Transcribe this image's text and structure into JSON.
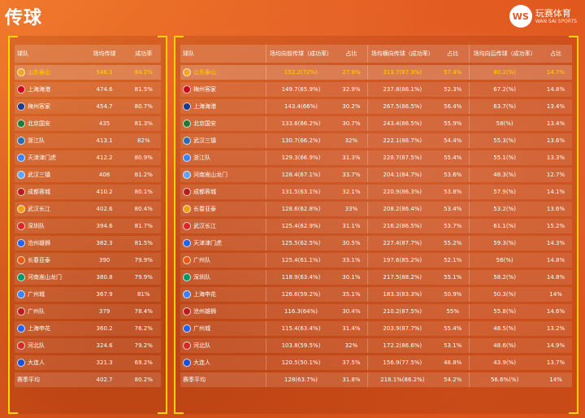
{
  "title": "传球",
  "logo": {
    "badge": "WS",
    "text": "玩赛体育",
    "sub": "WAN SAI SPORTS"
  },
  "colors": {
    "background": "#e2581c",
    "highlight": "#ffd400",
    "text": "#ffffff"
  },
  "chart_data": [
    {
      "type": "table",
      "columns": [
        "球队",
        "场均传球",
        "成功率"
      ],
      "rows": [
        [
          "山东泰山",
          "546.1",
          "84.2%"
        ],
        [
          "上海海港",
          "474.6",
          "81.5%"
        ],
        [
          "梅州客家",
          "454.7",
          "80.7%"
        ],
        [
          "北京国安",
          "435",
          "81.3%"
        ],
        [
          "浙江队",
          "413.1",
          "82%"
        ],
        [
          "天津津门虎",
          "412.2",
          "80.9%"
        ],
        [
          "武汉三镇",
          "408",
          "81.2%"
        ],
        [
          "成都蓉城",
          "410.2",
          "80.1%"
        ],
        [
          "武汉长江",
          "402.6",
          "80.4%"
        ],
        [
          "深圳队",
          "394.6",
          "81.7%"
        ],
        [
          "沧州雄狮",
          "382.3",
          "81.5%"
        ],
        [
          "长春亚泰",
          "390",
          "79.9%"
        ],
        [
          "河南嵩山龙门",
          "380.8",
          "79.9%"
        ],
        [
          "广州城",
          "367.9",
          "81%"
        ],
        [
          "广州队",
          "379",
          "78.4%"
        ],
        [
          "上海申花",
          "360.2",
          "76.2%"
        ],
        [
          "河北队",
          "324.6",
          "79.2%"
        ],
        [
          "大连人",
          "321.3",
          "69.2%"
        ]
      ],
      "footer": [
        "赛季平均",
        "402.7",
        "80.2%"
      ]
    },
    {
      "type": "table",
      "columns": [
        "球队",
        "场均向前传球（成功率）",
        "占比",
        "场均横向传球（成功率）",
        "占比",
        "场均向后传球（成功率）",
        "占比"
      ],
      "rows": [
        [
          "山东泰山",
          "152.2(72%)",
          "27.9%",
          "313.7(87.3%)",
          "57.4%",
          "80.2(%)",
          "14.7%"
        ],
        [
          "梅州客家",
          "149.7(65.9%)",
          "32.9%",
          "237.8(86.1%)",
          "52.3%",
          "67.2(%)",
          "14.8%"
        ],
        [
          "上海海港",
          "143.4(66%)",
          "30.2%",
          "267.5(86.5%)",
          "56.4%",
          "63.7(%)",
          "13.4%"
        ],
        [
          "北京国安",
          "133.6(66.2%)",
          "30.7%",
          "243.4(86.5%)",
          "55.9%",
          "58(%)",
          "13.4%"
        ],
        [
          "武汉三镇",
          "130.7(66.2%)",
          "32%",
          "222.1(86.7%)",
          "54.4%",
          "55.3(%)",
          "13.6%"
        ],
        [
          "浙江队",
          "129.3(66.9%)",
          "31.3%",
          "228.7(87.5%)",
          "55.4%",
          "55.1(%)",
          "13.3%"
        ],
        [
          "河南嵩山龙门",
          "128.4(67.1%)",
          "33.7%",
          "204.1(84.7%)",
          "53.6%",
          "48.3(%)",
          "12.7%"
        ],
        [
          "成都蓉城",
          "131.5(63.1%)",
          "32.1%",
          "220.9(86.3%)",
          "53.8%",
          "57.9(%)",
          "14.1%"
        ],
        [
          "长春亚泰",
          "128.6(62.8%)",
          "33%",
          "208.2(86.4%)",
          "53.4%",
          "53.2(%)",
          "13.6%"
        ],
        [
          "武汉长江",
          "125.4(62.9%)",
          "31.1%",
          "216.2(86.5%)",
          "53.7%",
          "61.1(%)",
          "15.2%"
        ],
        [
          "天津津门虎",
          "125.5(62.5%)",
          "30.5%",
          "227.4(87.7%)",
          "55.2%",
          "59.3(%)",
          "14.3%"
        ],
        [
          "广州队",
          "125.4(61.1%)",
          "33.1%",
          "197.6(85.2%)",
          "52.1%",
          "56(%)",
          "14.8%"
        ],
        [
          "深圳队",
          "118.9(63.4%)",
          "30.1%",
          "217.5(88.2%)",
          "55.1%",
          "58.2(%)",
          "14.8%"
        ],
        [
          "上海申花",
          "126.6(59.2%)",
          "35.1%",
          "183.3(83.3%)",
          "50.9%",
          "50.3(%)",
          "14%"
        ],
        [
          "沧州雄狮",
          "116.3(64%)",
          "30.4%",
          "210.2(87.5%)",
          "55%",
          "55.8(%)",
          "14.6%"
        ],
        [
          "广州城",
          "115.4(63.4%)",
          "31.4%",
          "203.9(87.7%)",
          "55.4%",
          "48.5(%)",
          "13.2%"
        ],
        [
          "河北队",
          "103.8(59.5%)",
          "32%",
          "172.2(86.6%)",
          "53.1%",
          "48.6(%)",
          "14.9%"
        ],
        [
          "大连人",
          "120.5(50.1%)",
          "37.5%",
          "156.9(77.5%)",
          "48.8%",
          "43.9(%)",
          "13.7%"
        ]
      ],
      "footer": [
        "赛季平均",
        "128(63.7%)",
        "31.8%",
        "218.1%(86.2%)",
        "54.2%",
        "56.6%(%)",
        "14%"
      ]
    }
  ]
}
